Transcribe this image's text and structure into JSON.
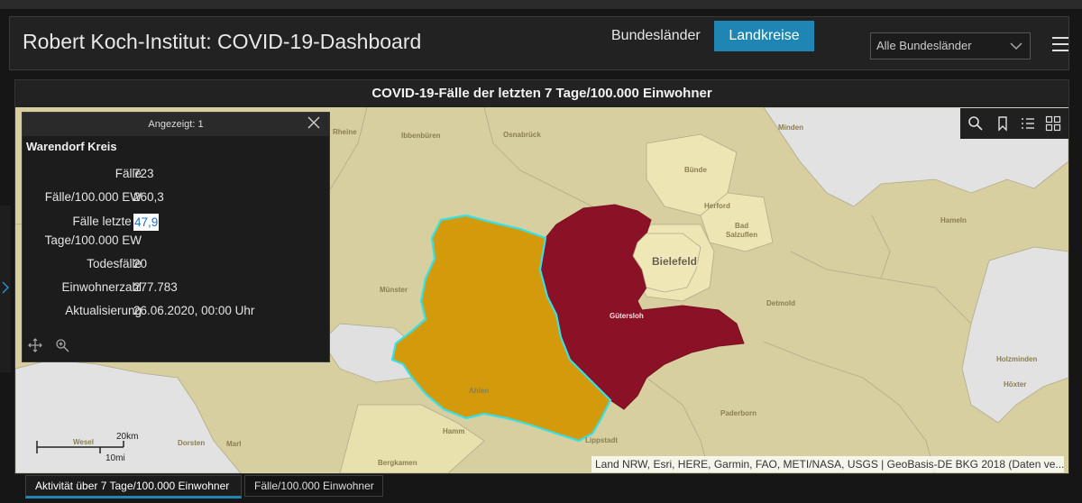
{
  "header": {
    "title": "Robert Koch-Institut: COVID-19-Dashboard",
    "nav": [
      "Bundesländer",
      "Landkreise"
    ],
    "active_nav": "Landkreise",
    "region_select": "Alle Bundesländer"
  },
  "map_panel": {
    "title": "COVID-19-Fälle der letzten 7 Tage/100.000 Einwohner",
    "attribution": "Land NRW, Esri, HERE, Garmin, FAO, METI/NASA, USGS | GeoBasis-DE BKG 2018 (Daten ve...",
    "scale": {
      "km": "20km",
      "mi": "10mi"
    },
    "place_labels": [
      "Rheine",
      "Ibbenbüren",
      "Osnabrück",
      "Minden",
      "Bünde",
      "Herford",
      "Bad Salzuflen",
      "Bielefeld",
      "Hameln",
      "Münster",
      "Gütersloh",
      "Detmold",
      "Ahlen",
      "Holzminden",
      "Höxter",
      "Hamm",
      "Lippstadt",
      "Paderborn",
      "Wesel",
      "Dorsten",
      "Marl",
      "Bergkamen"
    ],
    "region_colors": {
      "warendorf": "#d39b0c",
      "guetersloh": "#8b1126",
      "light": "#e8e0ad",
      "base": "#d7cf9f",
      "neighbor": "#e0e0e0"
    },
    "tools": [
      "search-icon",
      "bookmark-icon",
      "legend-icon",
      "basemap-icon"
    ]
  },
  "popup": {
    "header": "Angezeigt: 1",
    "feature": "Warendorf Kreis",
    "fields": [
      {
        "label": "Fälle",
        "value": "723"
      },
      {
        "label": "Fälle/100.000 EW",
        "value": "260,3"
      },
      {
        "label": "Fälle letzte 7 Tage/100.000 EW",
        "value": "47,9"
      },
      {
        "label": "Todesfälle",
        "value": "20"
      },
      {
        "label": "Einwohnerzahl",
        "value": "277.783"
      },
      {
        "label": "Aktualisierung",
        "value": "26.06.2020, 00:00 Uhr"
      }
    ],
    "footer_tools": [
      "pan-icon",
      "zoom-to-icon"
    ]
  },
  "tabs": [
    "Aktivität über 7 Tage/100.000 Einwohner",
    "Fälle/100.000 Einwohner"
  ],
  "active_tab": "Aktivität über 7 Tage/100.000 Einwohner"
}
